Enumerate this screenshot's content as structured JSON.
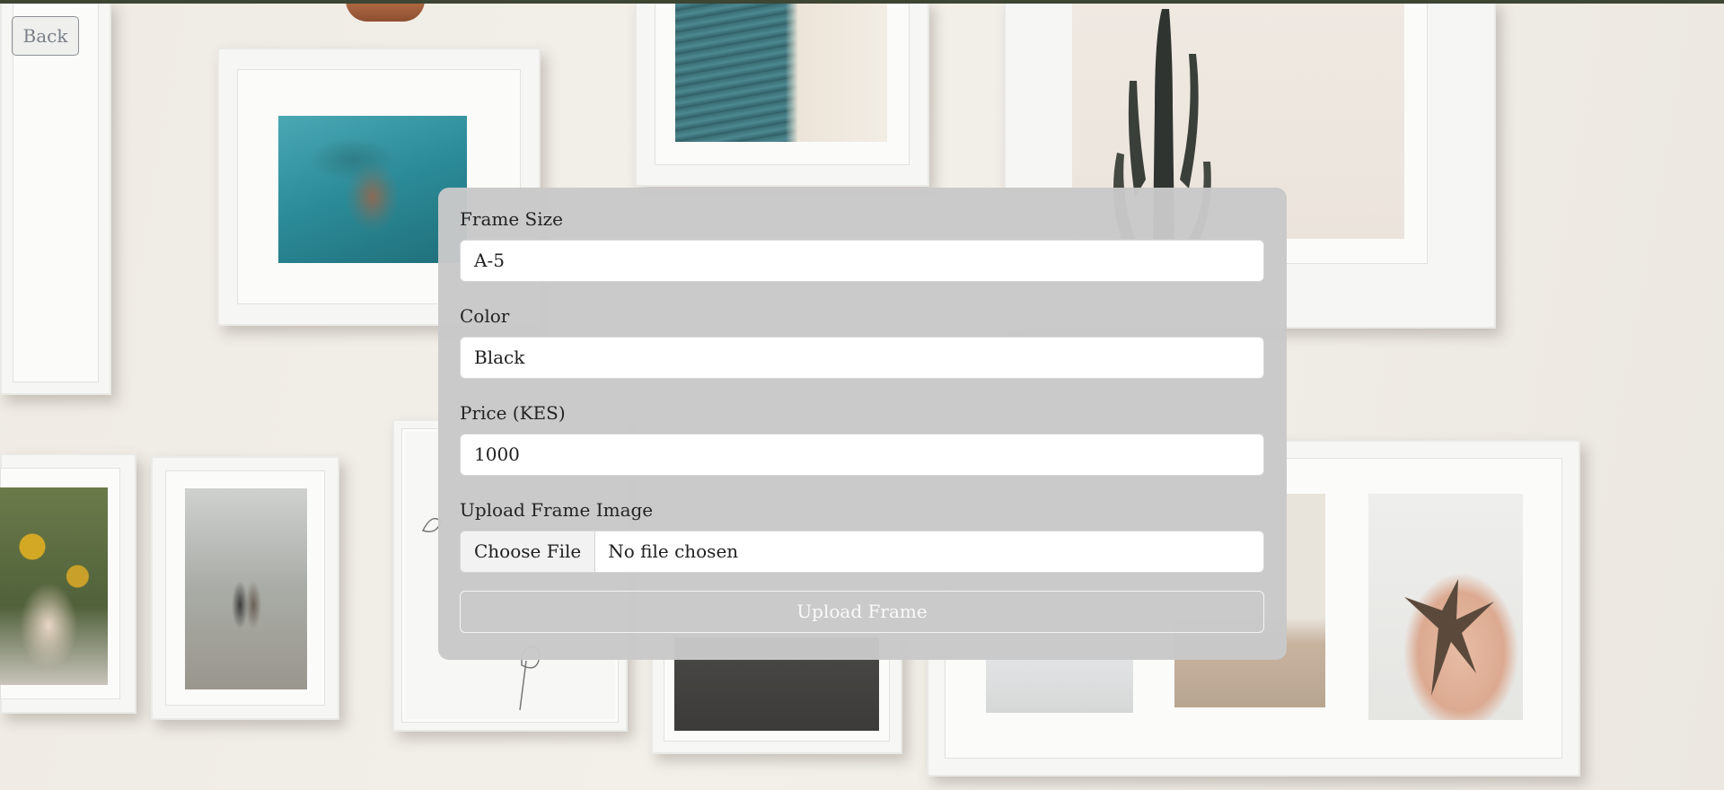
{
  "nav": {
    "back_label": "Back"
  },
  "form": {
    "frame_size": {
      "label": "Frame Size",
      "value": "A-5"
    },
    "color": {
      "label": "Color",
      "value": "Black"
    },
    "price": {
      "label": "Price (KES)",
      "value": "1000"
    },
    "image": {
      "label": "Upload Frame Image",
      "button_label": "Choose File",
      "status": "No file chosen"
    },
    "submit_label": "Upload Frame"
  },
  "theme": {
    "top_bar_color": "#3d4533",
    "panel_background": "#c8c8c9",
    "input_background": "#ffffff"
  },
  "background": {
    "description_icon": "photo-frame-wall-background"
  }
}
